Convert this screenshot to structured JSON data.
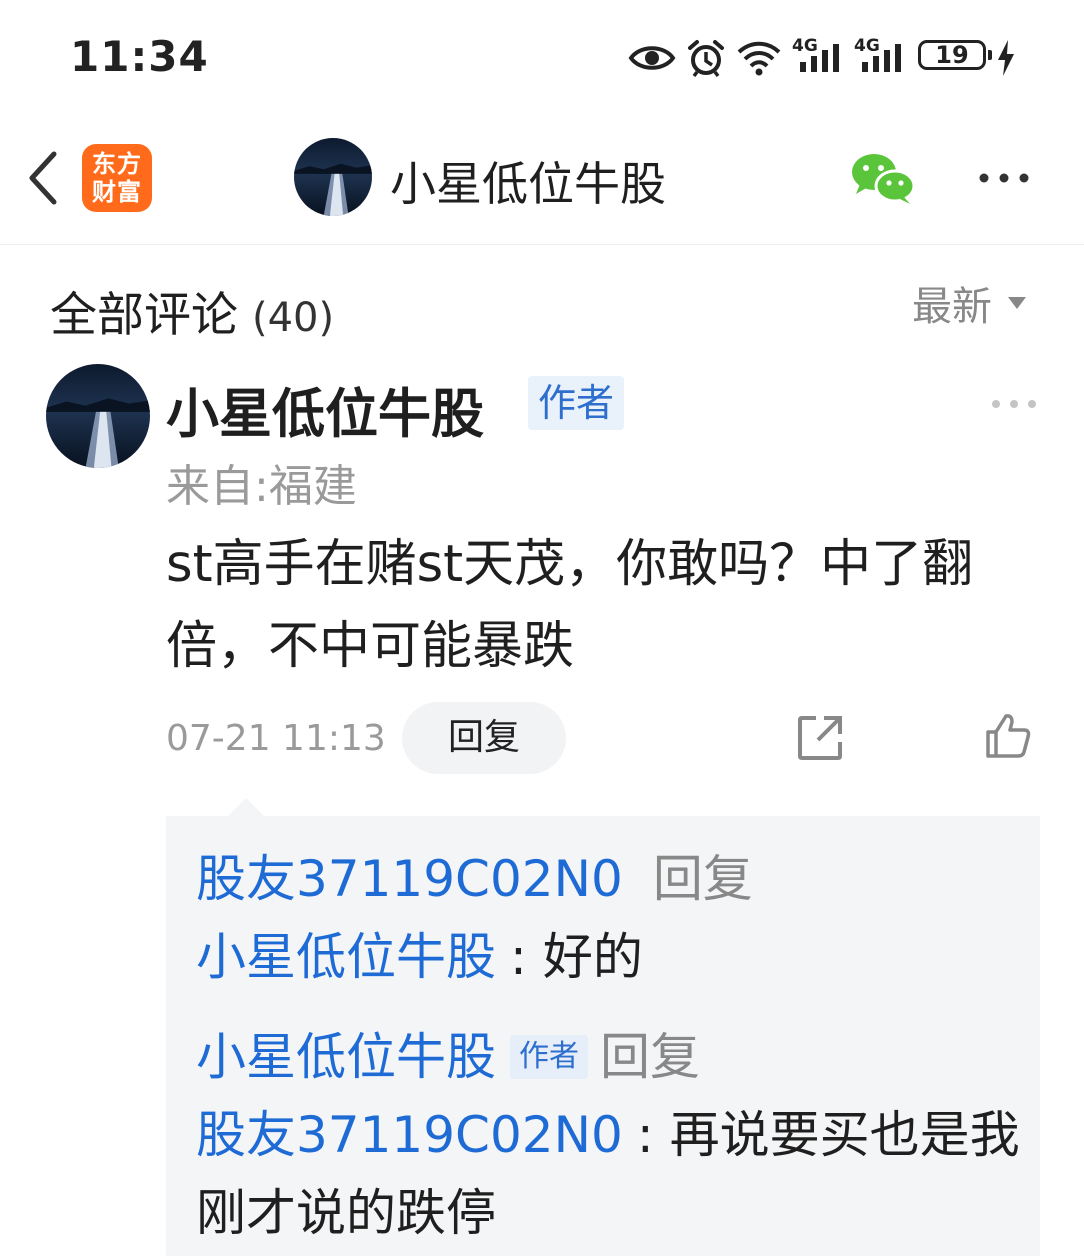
{
  "status_bar": {
    "time": "11:34",
    "battery": "19",
    "signal1_label": "4G",
    "signal2_label": "4G",
    "icons": [
      "eye-icon",
      "alarm-icon",
      "wifi-icon",
      "signal-icon",
      "signal-icon",
      "battery-icon",
      "charging-icon"
    ]
  },
  "nav": {
    "brand_line1": "东方",
    "brand_line2": "财富",
    "title": "小星低位牛股",
    "brand_color": "#ff6b1a",
    "icons": [
      "back-icon",
      "wechat-icon",
      "more-icon"
    ]
  },
  "comments": {
    "title": "全部评论",
    "count": "(40)",
    "sort_label": "最新"
  },
  "comment": {
    "author": "小星低位牛股",
    "author_badge": "作者",
    "location": "来自:福建",
    "text": "st高手在赌st天茂，你敢吗？中了翻倍，不中可能暴跌",
    "time": "07-21 11:13",
    "reply_label": "回复",
    "icons": [
      "share-icon",
      "like-icon",
      "more-icon"
    ]
  },
  "replies": [
    {
      "from": "股友37119C02N0",
      "action": "回复",
      "to": "小星低位牛股",
      "separator": ":",
      "text": "好的"
    },
    {
      "from": "小星低位牛股",
      "from_badge": "作者",
      "action": "回复",
      "to": "股友37119C02N0",
      "separator": ":",
      "text": "再说要买也是我刚才说的跌停"
    }
  ],
  "colors": {
    "link_blue": "#1e6bd6",
    "badge_text": "#2e6fce",
    "badge_bg": "#e9f1fb",
    "muted": "#9a9a9a",
    "reply_bg": "#f4f5f7"
  }
}
